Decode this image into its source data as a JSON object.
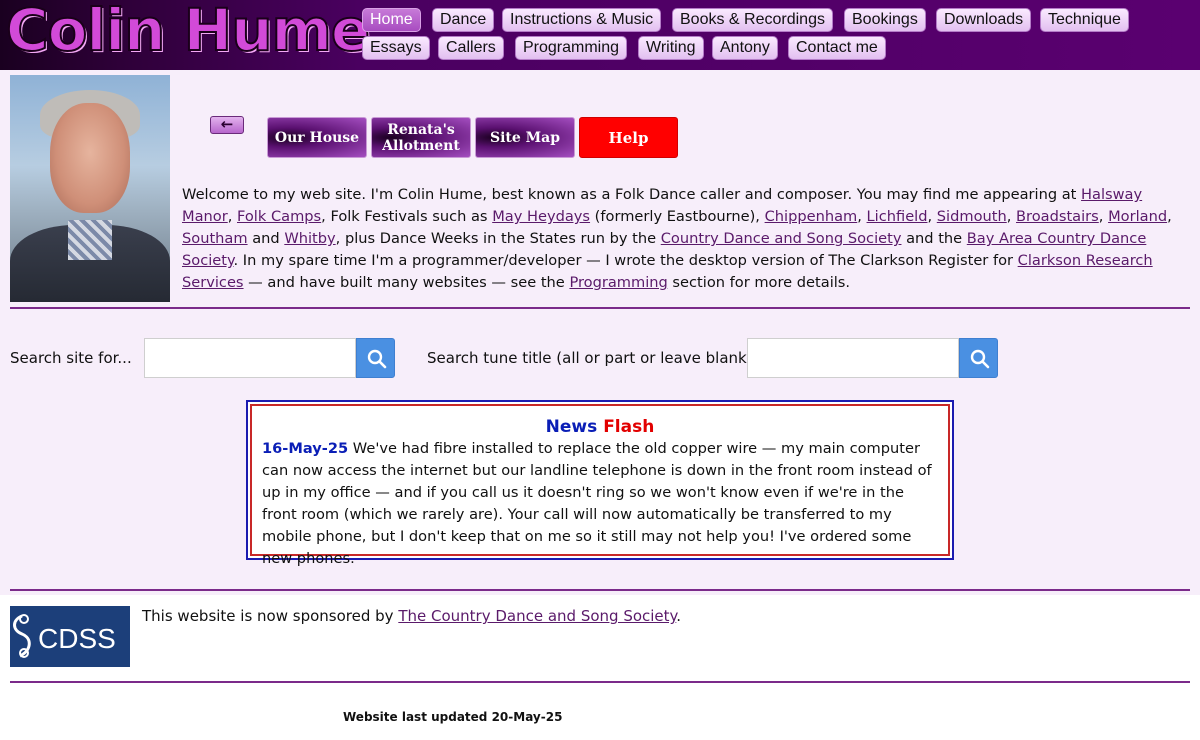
{
  "header": {
    "site_title": "Colin Hume",
    "nav_row1": [
      "Home",
      "Dance",
      "Instructions & Music",
      "Books & Recordings",
      "Bookings",
      "Downloads",
      "Technique"
    ],
    "nav_row2": [
      "Essays",
      "Callers",
      "Programming",
      "Writing",
      "Antony",
      "Contact me"
    ],
    "active_nav": "Home"
  },
  "quicklinks": {
    "back_icon": "left-arrow-icon",
    "our_house": "Our House",
    "renatas_allotment": "Renata's Allotment",
    "site_map": "Site Map",
    "help": "Help"
  },
  "intro": {
    "t1": "Welcome to my web site.  I'm Colin Hume, best known as a Folk Dance caller and composer.  You may find me appearing at ",
    "halsway": "Halsway Manor",
    "t2": ", ",
    "folk_camps": "Folk Camps",
    "t3": ",  Folk Festivals such as ",
    "may_heydays": "May Heydays",
    "t4": " (formerly Eastbourne),  ",
    "chippenham": "Chippenham",
    "t5": ",  ",
    "lichfield": "Lichfield",
    "t6": ",  ",
    "sidmouth": "Sidmouth",
    "t7": ",  ",
    "broadstairs": "Broadstairs",
    "t8": ",  ",
    "morland": "Morland",
    "t9": ",  ",
    "southam": "Southam",
    "t10": " and ",
    "whitby": "Whitby",
    "t11": ",  plus Dance Weeks in the States run by the ",
    "cdss": "Country Dance and Song Society",
    "t12": " and the ",
    "bacds": "Bay Area Country Dance Society",
    "t13": ".  In my spare time I'm a programmer/developer — I wrote the desktop version of The Clarkson Register for ",
    "clarkson": "Clarkson Research Services",
    "t14": " — and have built many websites — see the ",
    "programming": "Programming",
    "t15": " section for more details."
  },
  "search": {
    "site_label": "Search site for...",
    "site_value": "",
    "tune_label": "Search tune title (all or part or leave blank)",
    "tune_value": "",
    "icon": "search-icon"
  },
  "news": {
    "title_word1": "News",
    "title_word2": "Flash",
    "date": "16-May-25",
    "body": "  We've had fibre installed to replace the old copper wire — my main computer can now access the internet but our landline telephone is down in the front room instead of up in my office — and if you call us it doesn't ring so we won't know even if we're in the front room (which we rarely are).  Your call will now automatically be transferred to my mobile phone, but I don't keep that on me so it still may not help you!  I've ordered some new phones."
  },
  "sponsor": {
    "logo_text": "CDSS",
    "text_before": "This website is now sponsored by ",
    "link": "The Country Dance and Song Society",
    "text_after": "."
  },
  "footer": {
    "updated": "Website last updated 20-May-25"
  }
}
